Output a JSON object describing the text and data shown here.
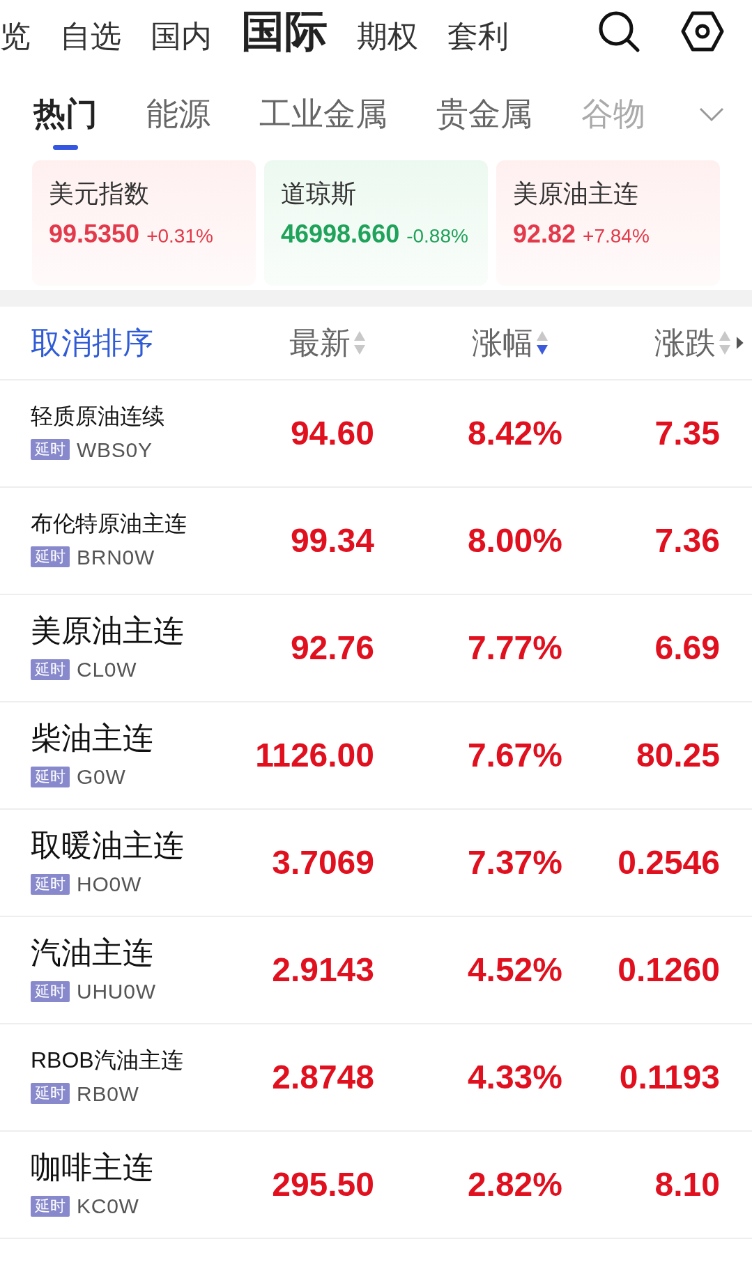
{
  "top_tabs": [
    {
      "label": "览",
      "selected": false
    },
    {
      "label": "自选",
      "selected": false
    },
    {
      "label": "国内",
      "selected": false
    },
    {
      "label": "国际",
      "selected": true
    },
    {
      "label": "期权",
      "selected": false
    },
    {
      "label": "套利",
      "selected": false
    }
  ],
  "sub_tabs": [
    {
      "label": "热门",
      "selected": true
    },
    {
      "label": "能源",
      "selected": false
    },
    {
      "label": "工业金属",
      "selected": false
    },
    {
      "label": "贵金属",
      "selected": false
    },
    {
      "label": "谷物",
      "selected": false
    }
  ],
  "index_cards": [
    {
      "name": "美元指数",
      "price": "99.5350",
      "change": "+0.31%",
      "rising": true
    },
    {
      "name": "道琼斯",
      "price": "46998.660",
      "change": "-0.88%",
      "rising": false
    },
    {
      "name": "美原油主连",
      "price": "92.82",
      "change": "+7.84%",
      "rising": true
    }
  ],
  "table": {
    "cancel_sort": "取消排序",
    "columns": [
      {
        "label": "最新",
        "sorted": false
      },
      {
        "label": "涨幅",
        "sorted": true
      },
      {
        "label": "涨跌",
        "sorted": false
      }
    ],
    "rows": [
      {
        "name": "轻质原油连续",
        "tag": "延时",
        "code": "WBS0Y",
        "price": "94.60",
        "pct": "8.42%",
        "change": "7.35"
      },
      {
        "name": "布伦特原油主连",
        "tag": "延时",
        "code": "BRN0W",
        "price": "99.34",
        "pct": "8.00%",
        "change": "7.36"
      },
      {
        "name": "美原油主连",
        "tag": "延时",
        "code": "CL0W",
        "price": "92.76",
        "pct": "7.77%",
        "change": "6.69"
      },
      {
        "name": "柴油主连",
        "tag": "延时",
        "code": "G0W",
        "price": "1126.00",
        "pct": "7.67%",
        "change": "80.25"
      },
      {
        "name": "取暖油主连",
        "tag": "延时",
        "code": "HO0W",
        "price": "3.7069",
        "pct": "7.37%",
        "change": "0.2546"
      },
      {
        "name": "汽油主连",
        "tag": "延时",
        "code": "UHU0W",
        "price": "2.9143",
        "pct": "4.52%",
        "change": "0.1260"
      },
      {
        "name": "RBOB汽油主连",
        "tag": "延时",
        "code": "RB0W",
        "price": "2.8748",
        "pct": "4.33%",
        "change": "0.1193"
      },
      {
        "name": "咖啡主连",
        "tag": "延时",
        "code": "KC0W",
        "price": "295.50",
        "pct": "2.82%",
        "change": "8.10"
      }
    ]
  }
}
